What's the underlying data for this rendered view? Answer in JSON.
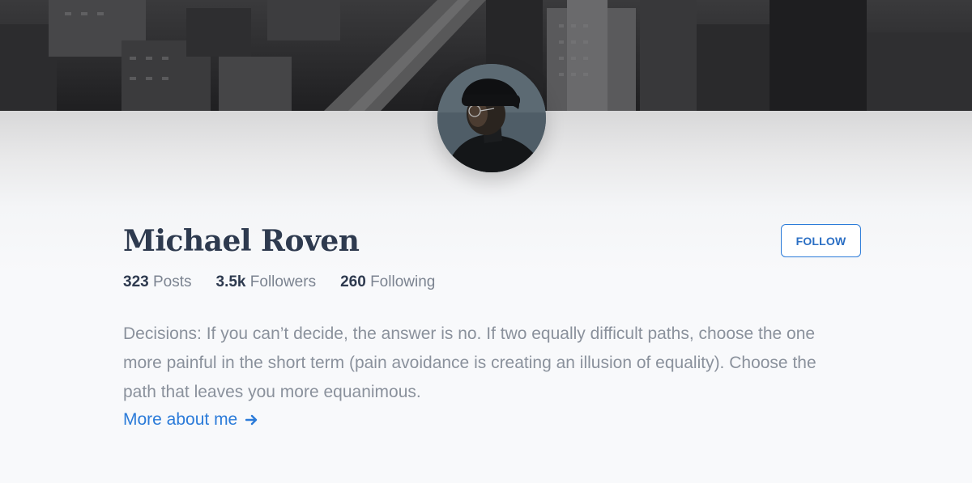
{
  "profile": {
    "name": "Michael Roven",
    "follow_label": "FOLLOW",
    "stats": [
      {
        "value": "323",
        "label": "Posts"
      },
      {
        "value": "3.5k",
        "label": "Followers"
      },
      {
        "value": "260",
        "label": "Following"
      }
    ],
    "bio": "Decisions: If you can’t decide, the answer is no. If two equally difficult paths, choose the one more painful in the short term (pain avoidance is creating an illusion of equality). Choose the path that leaves you more equanimous.",
    "more_link": "More about me"
  },
  "icons": {
    "more_link_icon": "arrow-right-icon"
  },
  "colors": {
    "accent": "#2b7bd9",
    "name_text": "#2e3a4f",
    "muted_text": "#8a919c"
  }
}
